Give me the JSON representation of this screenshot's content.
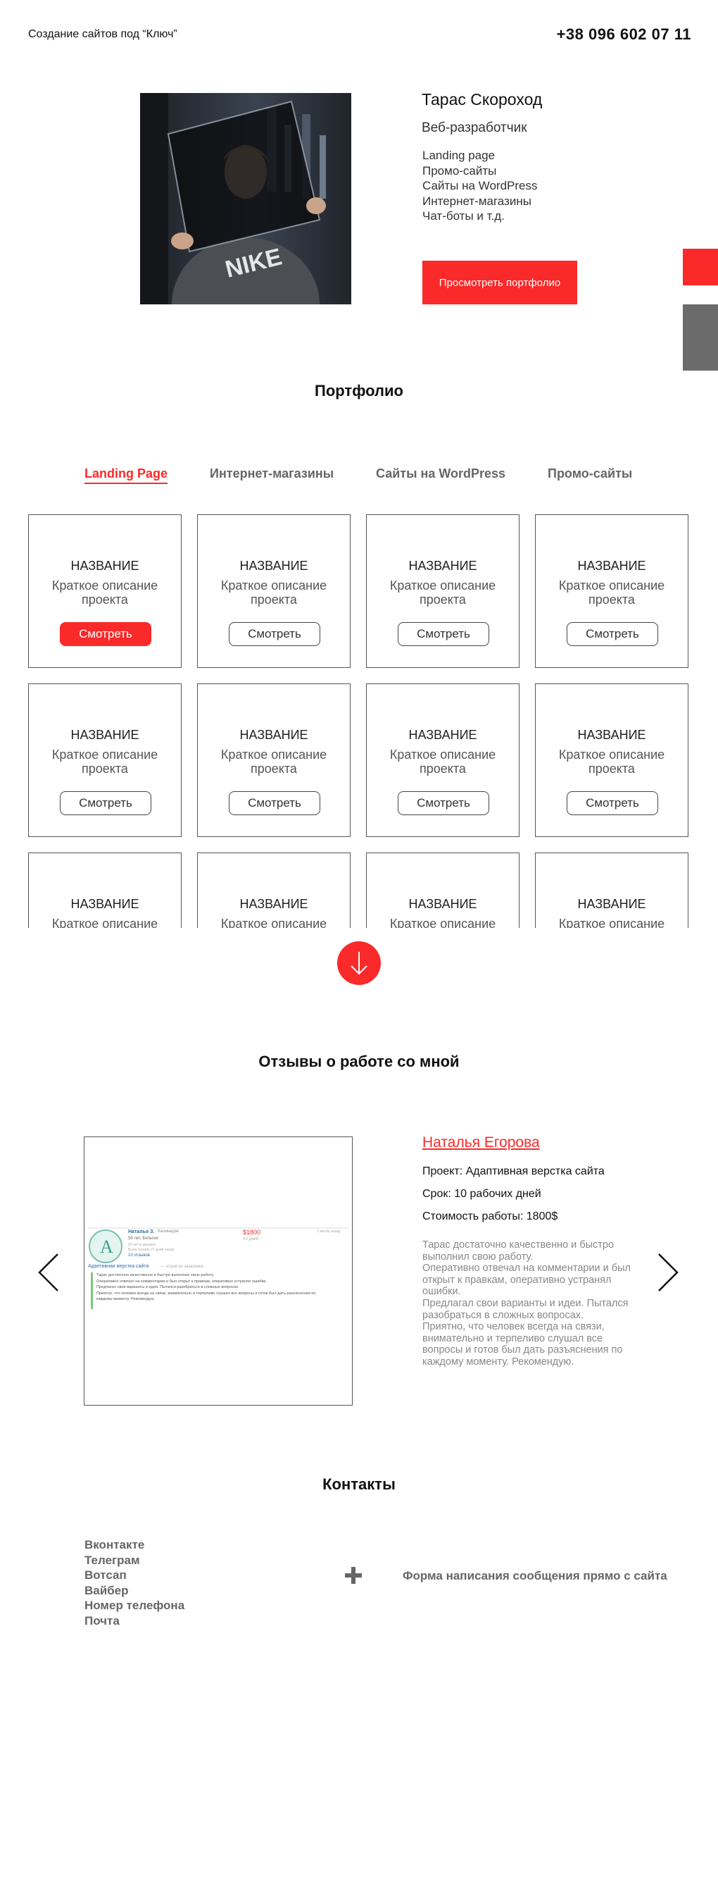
{
  "header": {
    "site_title": "Создание сайтов под  “Ключ”",
    "phone": "+38 096 602 07 11"
  },
  "hero": {
    "name": "Тарас Скороход",
    "role": "Веб-разработчик",
    "services": [
      "Landing page",
      "Промо-сайты",
      "Сайты на WordPress",
      "Интернет-магазины",
      "Чат-боты и т.д."
    ],
    "button_label": "Просмотреть портфолио"
  },
  "portfolio": {
    "title": "Портфолио",
    "tabs": [
      {
        "label": "Landing Page",
        "active": true
      },
      {
        "label": "Интернет-магазины",
        "active": false
      },
      {
        "label": "Сайты на WordPress",
        "active": false
      },
      {
        "label": "Промо-сайты",
        "active": false
      }
    ],
    "card": {
      "title": "НАЗВАНИЕ",
      "desc_line1": "Краткое описание",
      "desc_line2": "проекта",
      "button_label": "Смотреть"
    },
    "card_count": 12,
    "accent_color": "#fa2a2a"
  },
  "reviews": {
    "title": "Отзывы о работе со мной",
    "reviewer": "Наталья Егорова",
    "project": "Проект: Адаптивная верстка сайта",
    "term": "Срок: 10 рабочих дней",
    "cost": "Стоимость работы: 1800$",
    "text": "Тарас достаточно качественно и быстро выполнил свою работу.\nОперативно отвечал на комментарии и был открыт к правкам, оперативно устранял ошибки.\nПредлагал свои варианты и идеи. Пытался разобраться в сложных вопросах.\nПриятно, что человек всегда на связи, внимательно и терпеливо слушал все вопросы и готов был дать разъяснения по каждому моменту. Рекомендую.",
    "screenshot": {
      "name": "Наталья З.",
      "city": "Калинадзе",
      "price": "$1800",
      "days": "10 дней",
      "ago": "1 месяц назад",
      "age": "59 лет, Бельгия",
      "meta1": "20 лет в украине",
      "meta2": "Была онлайн 27 дней назад",
      "reviews_count": "10 отзывов",
      "project_link": "Адаптивная верстка сайта",
      "project_note": "— отзыв из заказчика",
      "lines": [
        "Тарас достаточно качественно и быстро выполнил свою работу.",
        "Оперативно отвечал на комментарии и был открыт к правкам, оперативно устранял ошибки.",
        "Предлагал свои варианты и идеи. Пытался разобраться в сложных вопросах.",
        "Приятно, что человек всегда на связи, внимательно и терпеливо слушал все вопросы и готов был дать разъяснения по",
        "каждому моменту. Рекомендую."
      ]
    }
  },
  "contacts": {
    "title": "Контакты",
    "items": [
      "Вконтакте",
      "Телеграм",
      "Вотсап",
      "Вайбер",
      "Номер телефона",
      "Почта"
    ],
    "form_text": "Форма написания сообщения прямо с сайта"
  }
}
